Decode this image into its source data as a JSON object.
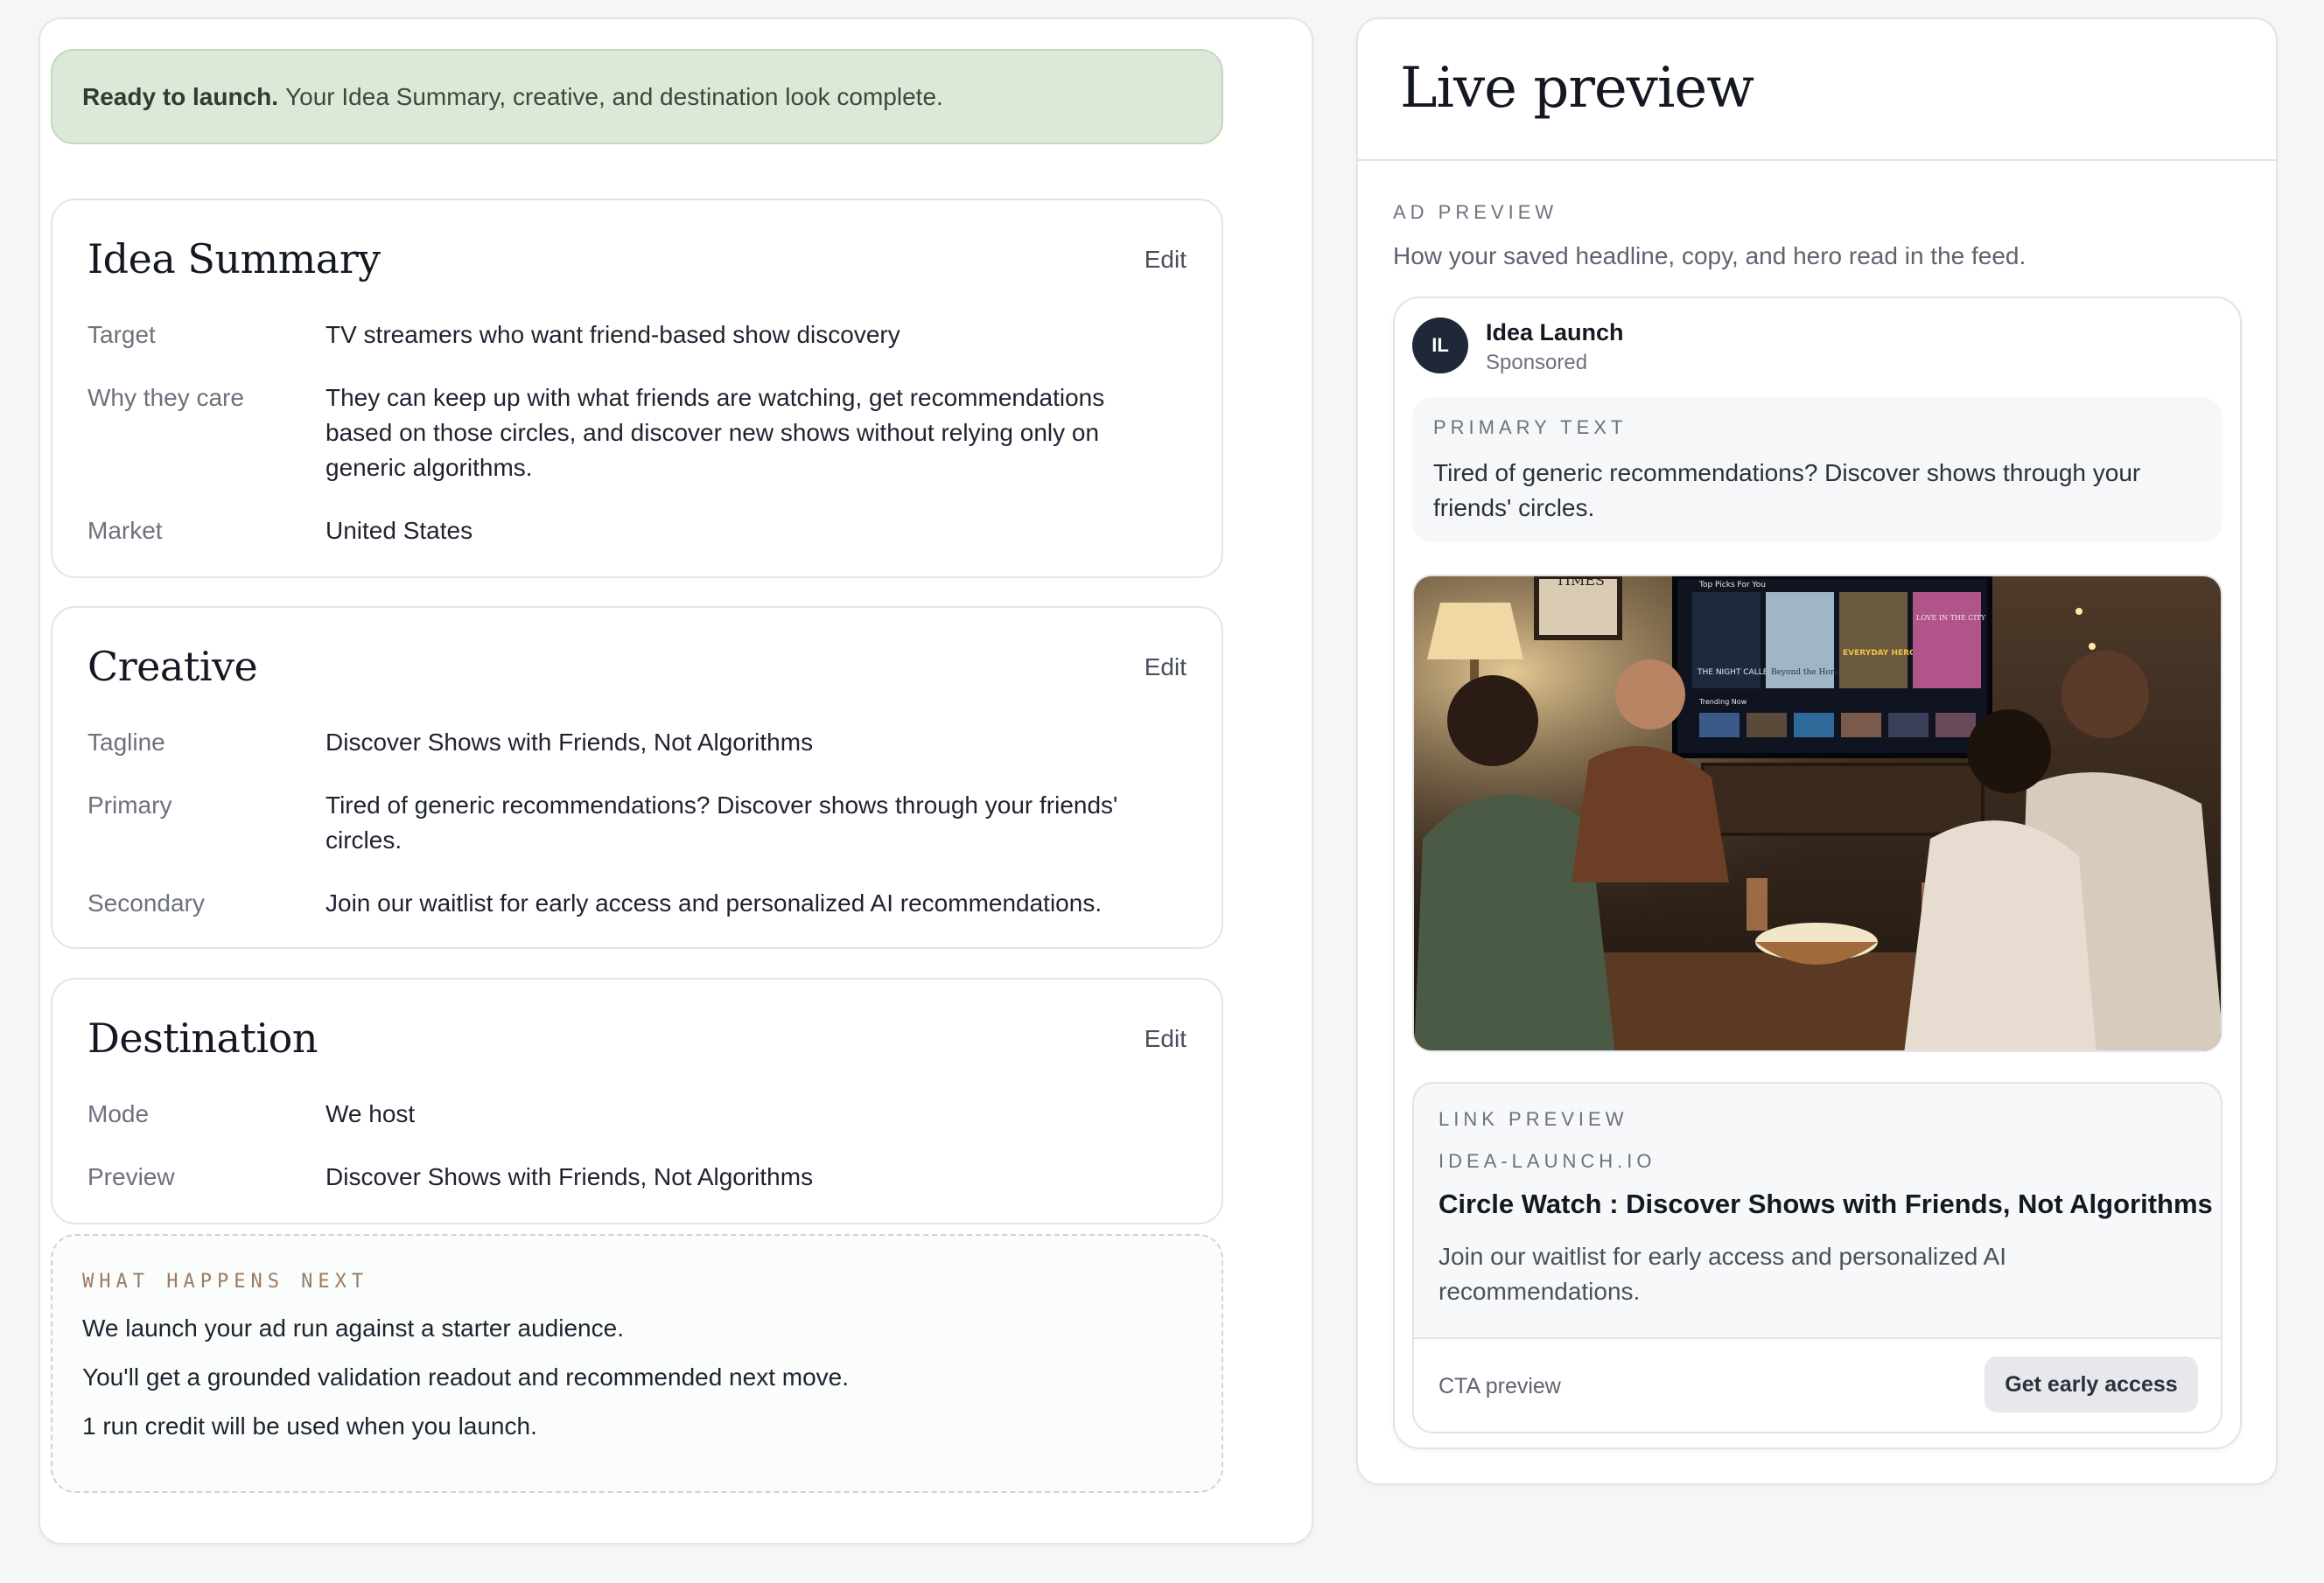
{
  "banner": {
    "bold": "Ready to launch.",
    "text": "Your Idea Summary, creative, and destination look complete."
  },
  "idea_summary": {
    "title": "Idea Summary",
    "edit": "Edit",
    "rows": [
      {
        "label": "Target",
        "value": "TV streamers who want friend-based show discovery"
      },
      {
        "label": "Why they care",
        "value": "They can keep up with what friends are watching, get recommendations based on those circles, and discover new shows without relying only on generic algorithms."
      },
      {
        "label": "Market",
        "value": "United States"
      }
    ]
  },
  "creative": {
    "title": "Creative",
    "edit": "Edit",
    "rows": [
      {
        "label": "Tagline",
        "value": "Discover Shows with Friends, Not Algorithms"
      },
      {
        "label": "Primary",
        "value": "Tired of generic recommendations? Discover shows through your friends' circles."
      },
      {
        "label": "Secondary",
        "value": "Join our waitlist for early access and personalized AI recommendations."
      }
    ]
  },
  "destination": {
    "title": "Destination",
    "edit": "Edit",
    "rows": [
      {
        "label": "Mode",
        "value": "We host"
      },
      {
        "label": "Preview",
        "value": "Discover Shows with Friends, Not Algorithms"
      }
    ]
  },
  "next_steps": {
    "title": "WHAT HAPPENS NEXT",
    "lines": [
      "We launch your ad run against a starter audience.",
      "You'll get a grounded validation readout and recommended next move.",
      "1 run credit will be used when you launch."
    ]
  },
  "preview": {
    "title": "Live preview",
    "eyebrow": "AD PREVIEW",
    "subtitle": "How your saved headline, copy, and hero read in the feed.",
    "account": {
      "initials": "IL",
      "name": "Idea Launch",
      "sub": "Sponsored"
    },
    "primary_label": "PRIMARY TEXT",
    "primary_text": "Tired of generic recommendations? Discover shows through your friends' circles.",
    "hero": {
      "tv_row_title": "Top Picks For You",
      "tv_trending": "Trending Now",
      "posters": [
        "THE NIGHT CALLER",
        "Beyond the Horizon",
        "EVERYDAY HEROES",
        "LOVE IN THE CITY"
      ],
      "wall_sign": "TIMES"
    },
    "link": {
      "label": "LINK PREVIEW",
      "domain": "IDEA-LAUNCH.IO",
      "headline": "Circle Watch : Discover Shows with Friends, Not Algorithms",
      "desc": "Join our waitlist for early access and personalized AI recommendations.",
      "cta_label": "CTA preview",
      "cta_button": "Get early access"
    }
  },
  "colors": {
    "banner_bg": "#dde9d8",
    "avatar_bg": "#1f2738",
    "eyebrow_accent": "#9a7b63"
  }
}
